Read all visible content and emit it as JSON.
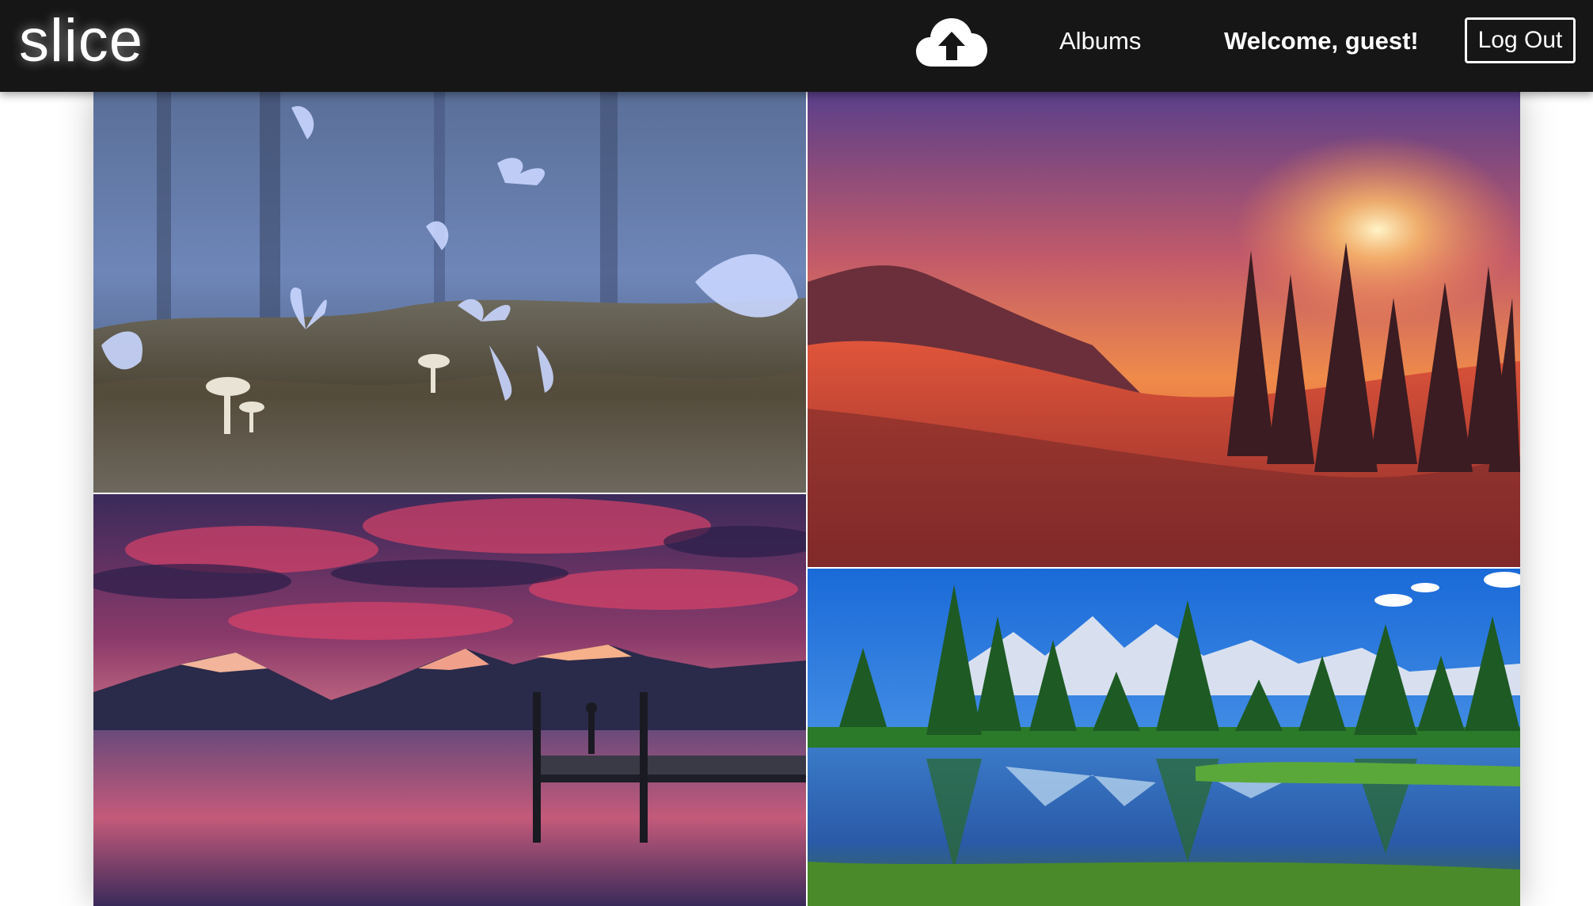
{
  "app": {
    "logo": "slice"
  },
  "navbar": {
    "upload_icon": "cloud-upload-icon",
    "albums_label": "Albums",
    "welcome_text": "Welcome, guest!",
    "logout_label": "Log Out"
  },
  "gallery": {
    "photos": [
      {
        "subject": "butterflies-mushrooms-forest",
        "accent": "#7f9ee0"
      },
      {
        "subject": "mountain-sunset-trees",
        "accent": "#e2553a"
      },
      {
        "subject": "lake-pier-pink-clouds",
        "accent": "#b43c6a"
      },
      {
        "subject": "green-forest-lake-mountains",
        "accent": "#2a8a32"
      }
    ]
  },
  "colors": {
    "navbar_bg": "#161616",
    "text": "#ffffff",
    "page_bg": "#ffffff"
  }
}
